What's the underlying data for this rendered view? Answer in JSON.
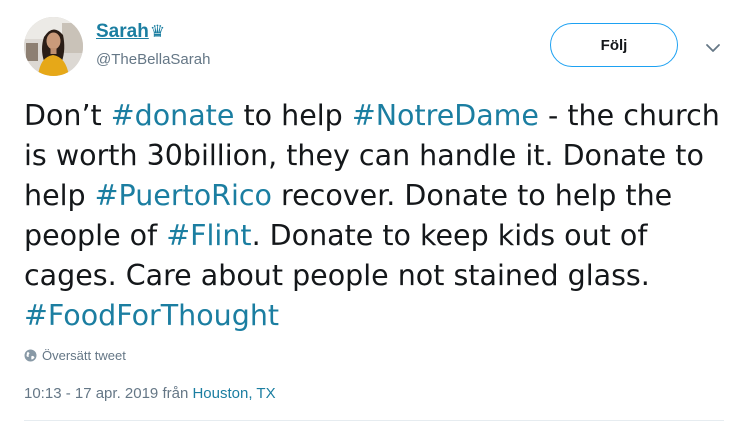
{
  "user": {
    "display_name": "Sarah",
    "badge_glyph": "♛",
    "handle": "@TheBellaSarah",
    "avatar_icon": "profile-photo"
  },
  "actions": {
    "follow_label": "Följ",
    "more_icon": "chevron-down-icon"
  },
  "tweet": {
    "segments": [
      {
        "text": "Don’t ",
        "hashtag": false
      },
      {
        "text": "#donate",
        "hashtag": true
      },
      {
        "text": " to help ",
        "hashtag": false
      },
      {
        "text": "#NotreDame",
        "hashtag": true
      },
      {
        "text": " - the church is worth 30billion, they can handle it. Donate to help ",
        "hashtag": false
      },
      {
        "text": "#PuertoRico",
        "hashtag": true
      },
      {
        "text": " recover. Donate to help the people of ",
        "hashtag": false
      },
      {
        "text": "#Flint",
        "hashtag": true
      },
      {
        "text": ". Donate to keep kids out of cages. Care about people not stained glass. ",
        "hashtag": false
      },
      {
        "text": "#FoodForThought",
        "hashtag": true
      }
    ]
  },
  "translate": {
    "label": "Översätt tweet",
    "icon": "globe-icon"
  },
  "meta": {
    "timestamp": "10:13 - 17 apr. 2019",
    "from_label": " från ",
    "location": "Houston, TX"
  },
  "colors": {
    "link": "#1b7ea1",
    "text": "#14171a",
    "muted": "#657786",
    "button_border": "#1da1f2"
  }
}
